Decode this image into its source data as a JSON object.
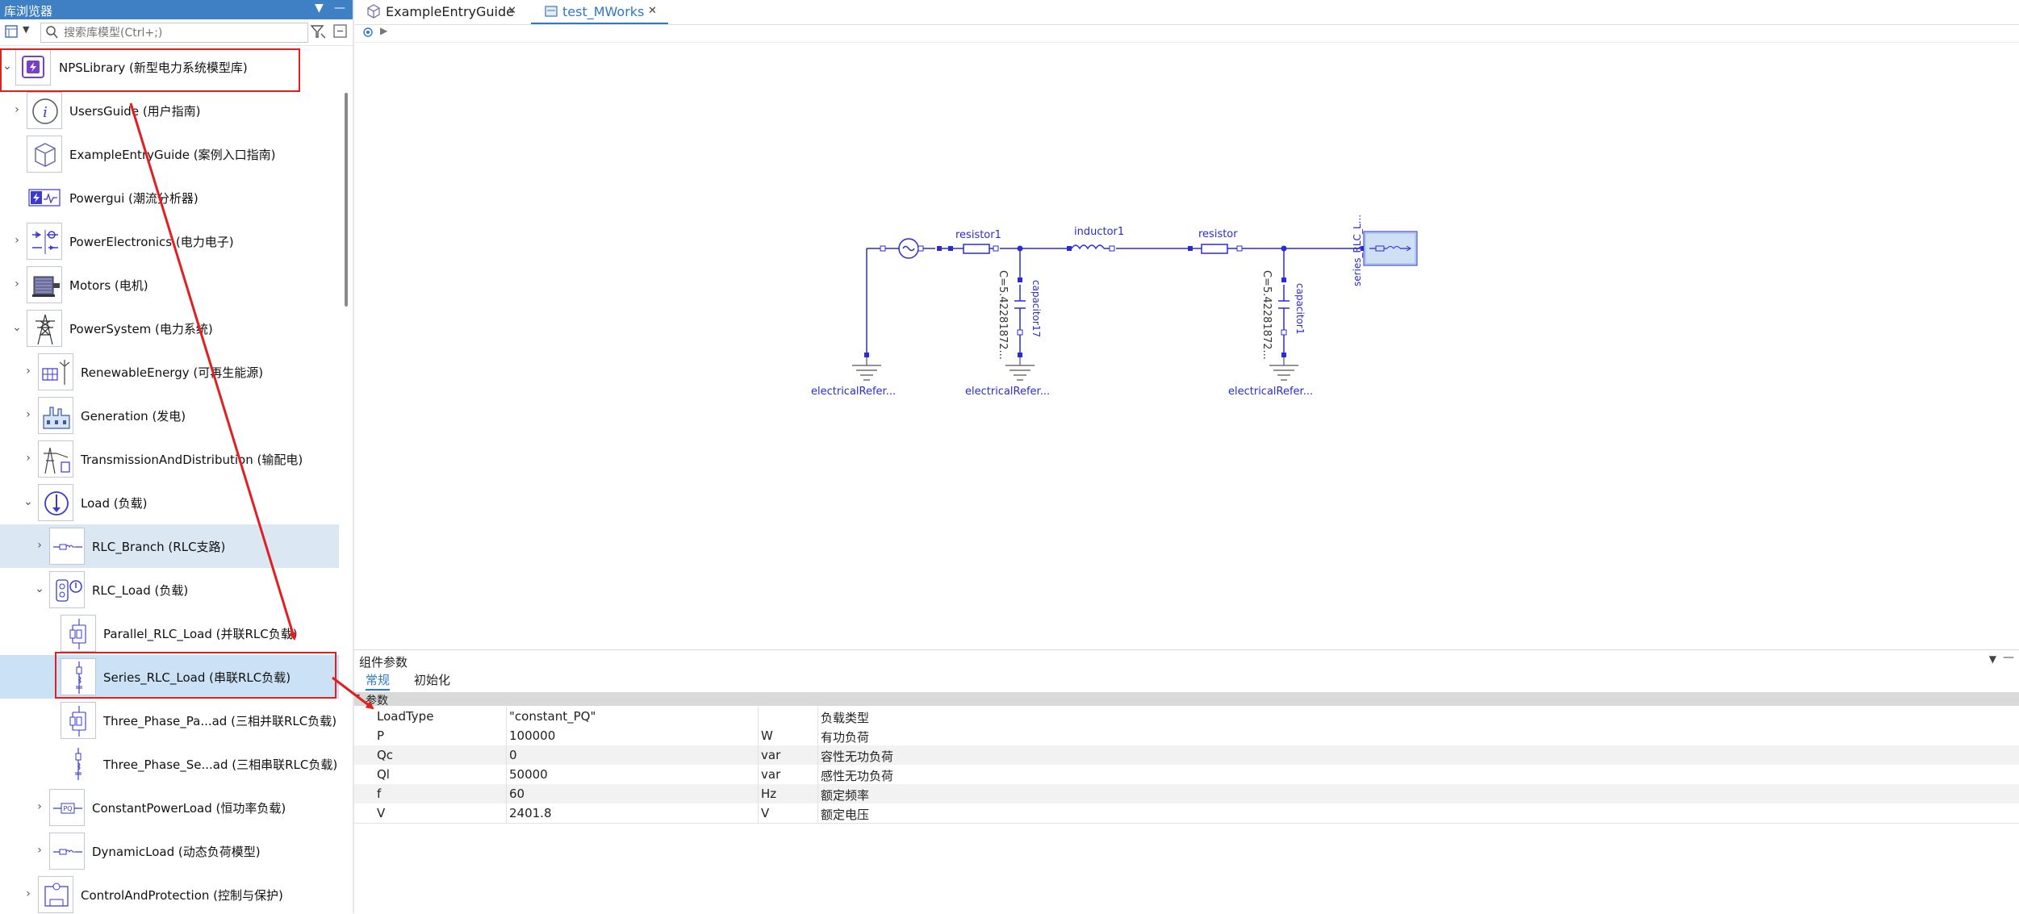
{
  "library": {
    "title": "库浏览器",
    "search_placeholder": "搜索库模型(Ctrl+;)"
  },
  "tree": [
    {
      "label": "NPSLibrary (新型电力系统模型库)",
      "chevron": "⌄",
      "icon": "library-icon"
    },
    {
      "label": "UsersGuide (用户指南)",
      "chevron": "›",
      "icon": "info-icon"
    },
    {
      "label": "ExampleEntryGuide (案例入口指南)",
      "chevron": "",
      "icon": "package-icon"
    },
    {
      "label": "Powergui (潮流分析器)",
      "chevron": "",
      "icon": "powergui-icon"
    },
    {
      "label": "PowerElectronics (电力电子)",
      "chevron": "›",
      "icon": "power-electronics-icon"
    },
    {
      "label": "Motors (电机)",
      "chevron": "›",
      "icon": "motor-icon"
    },
    {
      "label": "PowerSystem (电力系统)",
      "chevron": "⌄",
      "icon": "tower-icon"
    },
    {
      "label": "RenewableEnergy (可再生能源)",
      "chevron": "›",
      "icon": "solar-wind-icon"
    },
    {
      "label": "Generation (发电)",
      "chevron": "›",
      "icon": "factory-icon"
    },
    {
      "label": "TransmissionAndDistribution (输配电)",
      "chevron": "›",
      "icon": "transmission-icon"
    },
    {
      "label": "Load (负载)",
      "chevron": "⌄",
      "icon": "load-icon"
    },
    {
      "label": "RLC_Branch (RLC支路)",
      "chevron": "›",
      "icon": "rlc-branch-icon"
    },
    {
      "label": "RLC_Load (负载)",
      "chevron": "⌄",
      "icon": "rlc-load-icon"
    },
    {
      "label": "Parallel_RLC_Load (并联RLC负载)",
      "chevron": "",
      "icon": "parallel-rlc-icon"
    },
    {
      "label": "Series_RLC_Load (串联RLC负载)",
      "chevron": "",
      "icon": "series-rlc-icon"
    },
    {
      "label": "Three_Phase_Pa...ad (三相并联RLC负载)",
      "chevron": "",
      "icon": "three-phase-parallel-icon"
    },
    {
      "label": "Three_Phase_Se...ad (三相串联RLC负载)",
      "chevron": "",
      "icon": "three-phase-series-icon"
    },
    {
      "label": "ConstantPowerLoad (恒功率负载)",
      "chevron": "›",
      "icon": "pq-icon"
    },
    {
      "label": "DynamicLoad (动态负荷模型)",
      "chevron": "›",
      "icon": "dynamic-load-icon"
    },
    {
      "label": "ControlAndProtection (控制与保护)",
      "chevron": "›",
      "icon": "control-icon"
    }
  ],
  "tabs": [
    {
      "label": "ExampleEntryGuide",
      "close": "✕"
    },
    {
      "label": "test_MWorks",
      "close": "✕"
    }
  ],
  "diagram": {
    "labels": {
      "resistor1": "resistor1",
      "inductor1": "inductor1",
      "resistor": "resistor",
      "capacitor17": "capacitor17",
      "capacitor1": "capacitor1",
      "c_value_1": "C=5.42281872...",
      "c_value_2": "C=5.42281872...",
      "ground_1": "electricalRefer...",
      "ground_2": "electricalRefer...",
      "ground_3": "electricalRefer...",
      "series_load": "series_RLC_L..."
    },
    "line_color": "#2a2ad6"
  },
  "params": {
    "title": "组件参数",
    "tabs": [
      "常规",
      "初始化"
    ],
    "section": "参数",
    "rows": [
      {
        "name": "LoadType",
        "value": "\"constant_PQ\"",
        "unit": "",
        "desc": "负载类型"
      },
      {
        "name": "P",
        "value": "100000",
        "unit": "W",
        "desc": "有功负荷"
      },
      {
        "name": "Qc",
        "value": "0",
        "unit": "var",
        "desc": "容性无功负荷"
      },
      {
        "name": "Ql",
        "value": "50000",
        "unit": "var",
        "desc": "感性无功负荷"
      },
      {
        "name": "f",
        "value": "60",
        "unit": "Hz",
        "desc": "额定频率"
      },
      {
        "name": "V",
        "value": "2401.8",
        "unit": "V",
        "desc": "额定电压"
      }
    ]
  },
  "colors": {
    "accent": "#3f7fc4",
    "selection": "#cbe1f5",
    "annotation": "#e02020",
    "tab_active_text": "#2f78c4"
  }
}
